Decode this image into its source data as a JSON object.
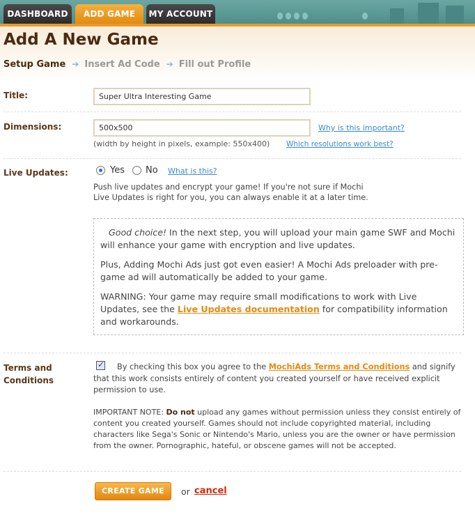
{
  "nav": {
    "tabs": [
      {
        "label": "DASHBOARD"
      },
      {
        "label": "ADD GAME"
      },
      {
        "label": "MY ACCOUNT"
      }
    ],
    "active_color": "#e48a10"
  },
  "page": {
    "title": "Add A New Game",
    "steps": [
      "Setup Game",
      "Insert Ad Code",
      "Fill out Profile"
    ]
  },
  "form": {
    "title_label": "Title:",
    "title_value": "Super Ultra Interesting Game",
    "dimensions_label": "Dimensions:",
    "dimensions_value": "500x500",
    "dimensions_link": "Why is this important?",
    "dimensions_hint": "(width by height in pixels, example: 550x400)",
    "resolutions_link": "Which resolutions work best?",
    "live_label": "Live Updates:",
    "yes_label": "Yes",
    "no_label": "No",
    "live_selected": "Yes",
    "live_link": "What is this?",
    "live_desc_1": "Push live updates and encrypt your game! If you're not sure if Mochi",
    "live_desc_2": "Live Updates is right for you, you can always enable it at a later time.",
    "box_p1_em": "Good choice!",
    "box_p1_rest": " In the next step, you will upload your main game SWF and Mochi will enhance your game with encryption and live updates.",
    "box_p2": "Plus, Adding Mochi Ads just got even easier! A Mochi Ads preloader with pre-game ad will automatically be added to your game.",
    "box_p3_a": "WARNING: Your game may require small modifications to work with Live Updates, see the ",
    "box_p3_link": "Live Updates documentation",
    "box_p3_b": " for compatibility information and workarounds.",
    "terms_label_1": "Terms and",
    "terms_label_2": "Conditions",
    "terms_checked": true,
    "terms_a": "By checking this box you agree to the ",
    "terms_link": "MochiAds Terms and Conditions",
    "terms_b": " and signify that this work consists entirely of content you created yourself or have received explicit permission to use.",
    "note_a": "IMPORTANT NOTE: ",
    "note_bold": "Do not",
    "note_b": " upload any games without permission unless they consist entirely of content you created yourself. Games should not include copyrighted material, including characters like Sega's Sonic or Nintendo's Mario, unless you are the owner or have permission from the owner. Pornographic, hateful, or obscene games will not be accepted.",
    "create_button": "CREATE GAME",
    "or_text": "or",
    "cancel_link": "cancel"
  }
}
